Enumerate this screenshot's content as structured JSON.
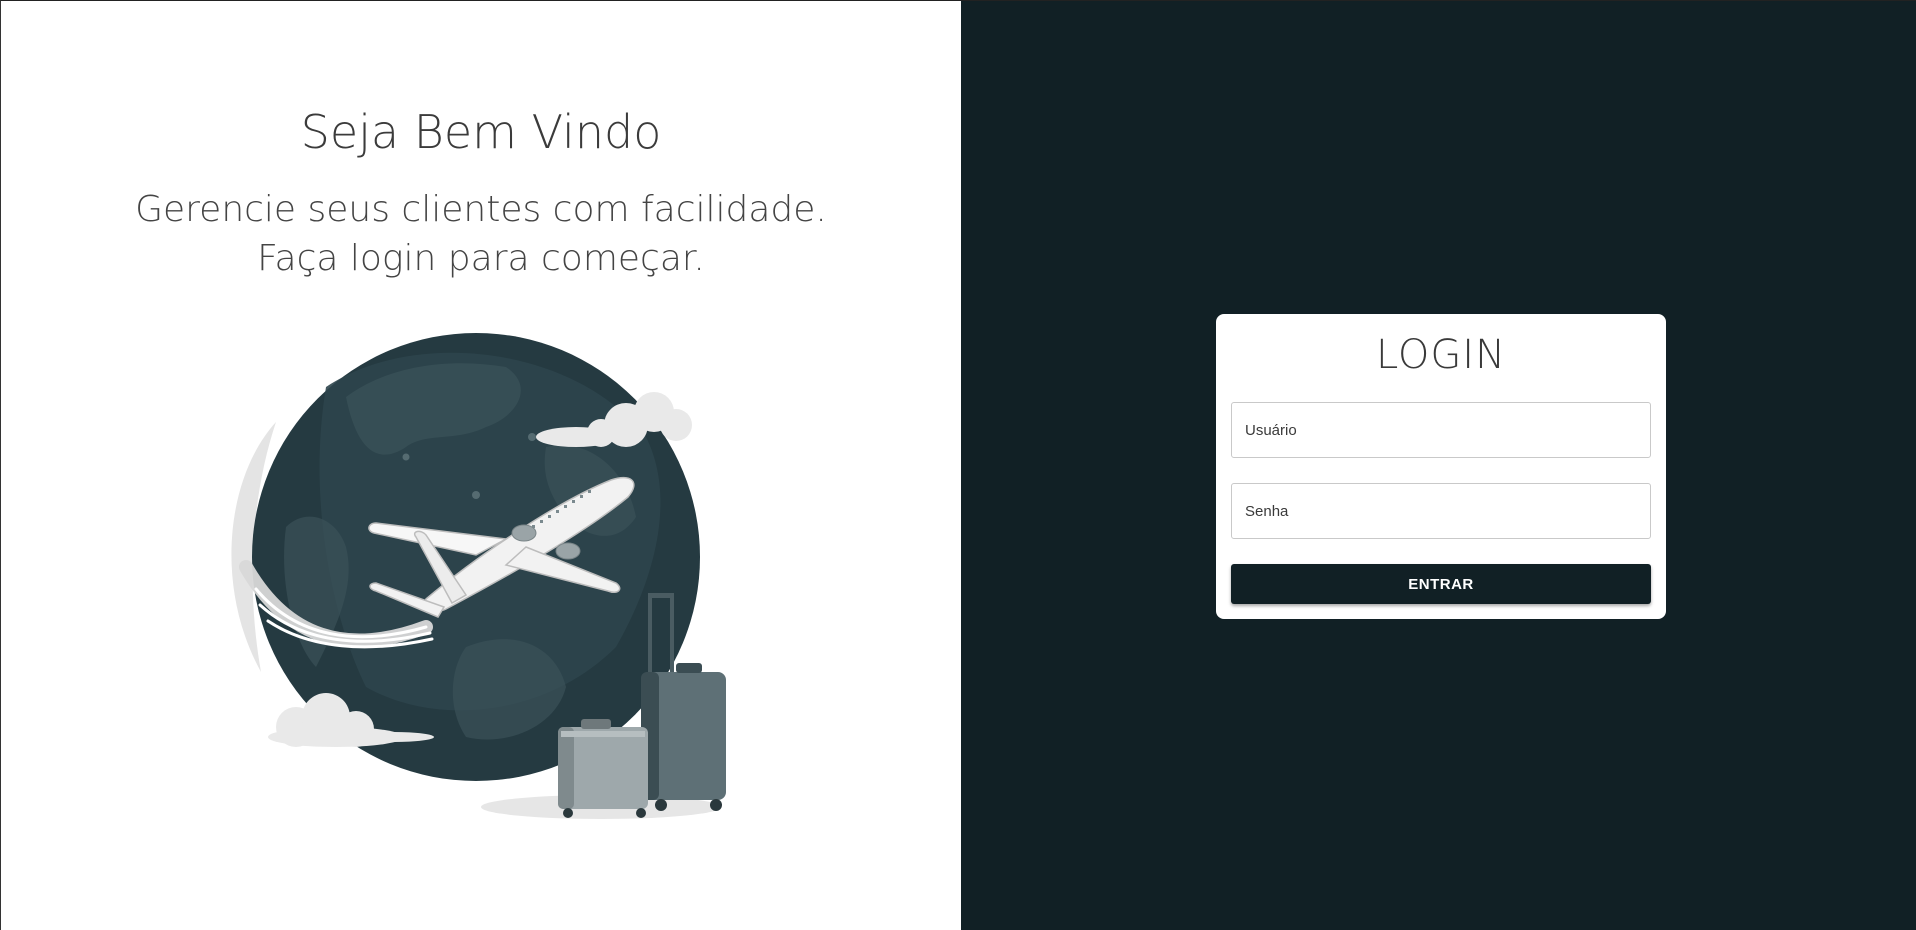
{
  "welcome": {
    "title": "Seja Bem Vindo",
    "subtitle_line1": "Gerencie seus clientes com facilidade.",
    "subtitle_line2": "Faça login para começar."
  },
  "illustration": {
    "icon": "travel-globe-airplane-luggage-illustration"
  },
  "login": {
    "title": "LOGIN",
    "username_placeholder": "Usuário",
    "username_value": "",
    "password_placeholder": "Senha",
    "password_value": "",
    "submit_label": "ENTRAR"
  },
  "colors": {
    "left_background": "#ffffff",
    "right_background": "#112025",
    "button_background": "#112025",
    "button_text": "#ffffff",
    "text_dark": "#3b3b3b"
  }
}
